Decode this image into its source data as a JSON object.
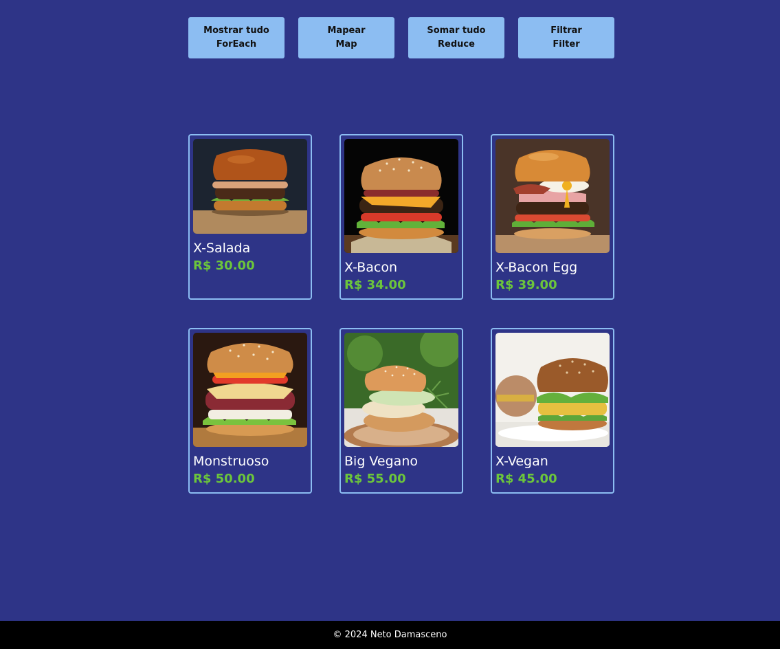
{
  "toolbar": {
    "buttons": [
      {
        "line1": "Mostrar tudo",
        "line2": "ForEach"
      },
      {
        "line1": "Mapear",
        "line2": "Map"
      },
      {
        "line1": "Somar tudo",
        "line2": "Reduce"
      },
      {
        "line1": "Filtrar",
        "line2": "Filter"
      }
    ]
  },
  "menu": {
    "items": [
      {
        "name": "X-Salada",
        "price": "R$ 30.00"
      },
      {
        "name": "X-Bacon",
        "price": "R$ 34.00"
      },
      {
        "name": "X-Bacon Egg",
        "price": "R$ 39.00"
      },
      {
        "name": "Monstruoso",
        "price": "R$ 50.00"
      },
      {
        "name": "Big Vegano",
        "price": "R$ 55.00"
      },
      {
        "name": "X-Vegan",
        "price": "R$ 45.00"
      }
    ]
  },
  "footer": {
    "text": "© 2024 Neto Damasceno"
  },
  "colors": {
    "background": "#2e3487",
    "button": "#8cbdf2",
    "card_border": "#8cbdf2",
    "price": "#6cc63b",
    "footer_bg": "#000000"
  }
}
